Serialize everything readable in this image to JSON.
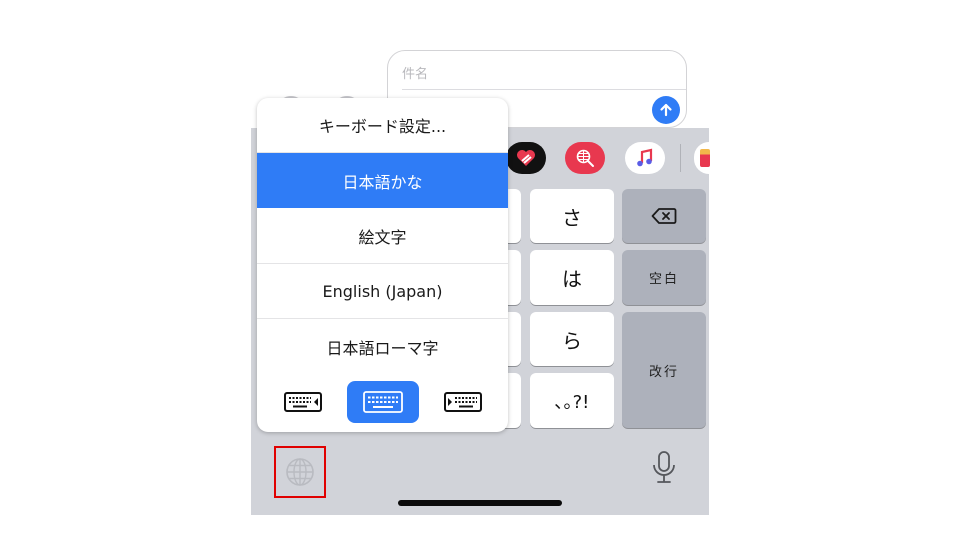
{
  "composer": {
    "subject_placeholder": "件名",
    "send_icon": "arrow-up-icon"
  },
  "app_strip": {
    "apps": [
      {
        "name": "heart-sticker-app-icon",
        "color": "#111111"
      },
      {
        "name": "web-search-app-icon",
        "color": "#e8384f"
      },
      {
        "name": "music-app-icon",
        "color": "#ffffff"
      },
      {
        "name": "gift-app-icon",
        "color": "#ffffff"
      }
    ]
  },
  "menu": {
    "items": [
      {
        "label": "キーボード設定...",
        "selected": false
      },
      {
        "label": "日本語かな",
        "selected": true
      },
      {
        "label": "絵文字",
        "selected": false
      },
      {
        "label": "English (Japan)",
        "selected": false
      },
      {
        "label": "日本語ローマ字",
        "selected": false
      }
    ],
    "keyboard_modes": [
      {
        "name": "keyboard-left-icon",
        "active": false
      },
      {
        "name": "keyboard-full-icon",
        "active": true
      },
      {
        "name": "keyboard-right-icon",
        "active": false
      }
    ]
  },
  "keys": {
    "sa": "さ",
    "ha": "は",
    "ra": "ら",
    "punct": "､｡?!",
    "delete_icon": "delete-icon",
    "space": "空白",
    "return": "改行"
  },
  "bottom": {
    "globe_icon": "globe-icon",
    "mic_icon": "microphone-icon"
  },
  "colors": {
    "accent": "#2f7cf6",
    "keyboard_bg": "#d1d3d9",
    "func_key": "#adb1bb",
    "highlight_box": "#e00000"
  }
}
